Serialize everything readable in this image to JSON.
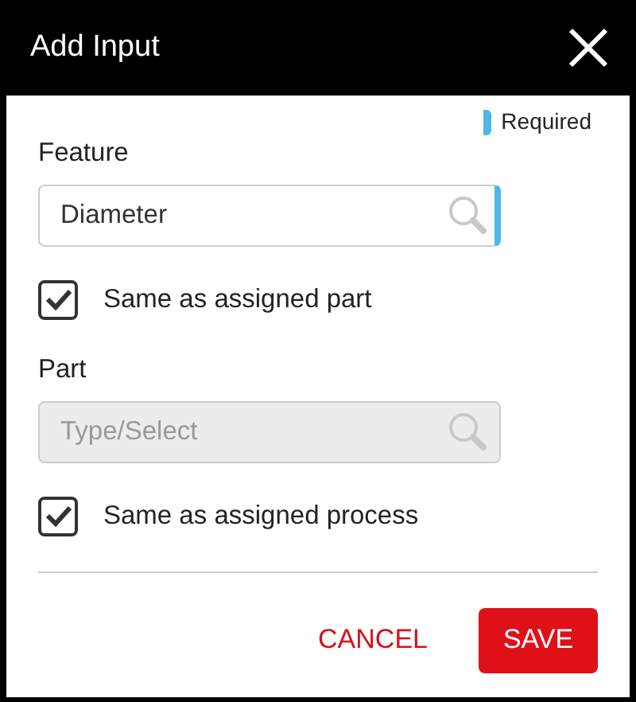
{
  "dialog": {
    "title": "Add Input"
  },
  "legend": {
    "label": "Required"
  },
  "sections": [
    {
      "label": "Feature",
      "value": "Diameter",
      "required": true,
      "disabled": false,
      "checkbox": {
        "label": "Same as assigned part",
        "checked": true
      }
    },
    {
      "label": "Part",
      "placeholder": "Type/Select",
      "required": false,
      "disabled": true,
      "checkbox": {
        "label": "Same as assigned process",
        "checked": true
      }
    }
  ],
  "buttons": [
    {
      "label": "CANCEL",
      "kind": "text"
    },
    {
      "label": "SAVE",
      "kind": "primary"
    }
  ]
}
